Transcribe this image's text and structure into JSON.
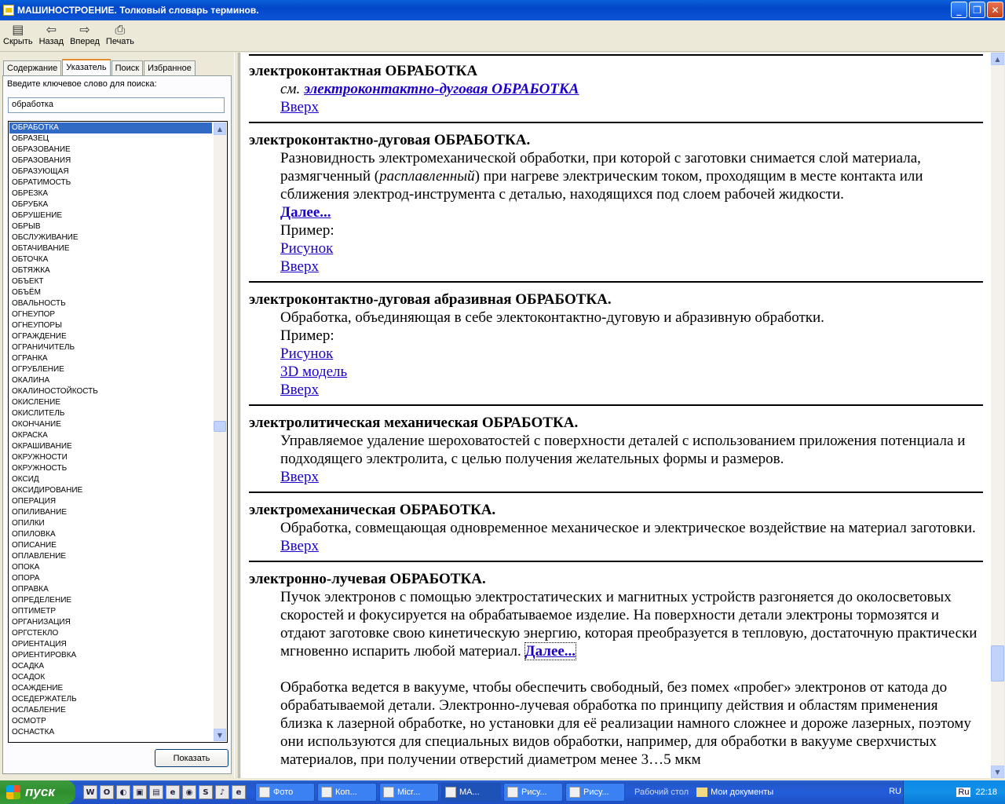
{
  "window": {
    "title": "МАШИНОСТРОЕНИЕ. Толковый словарь терминов."
  },
  "toolbar": {
    "buttons": [
      {
        "label": "Скрыть",
        "icon": "hide-icon"
      },
      {
        "label": "Назад",
        "icon": "back-arrow-icon"
      },
      {
        "label": "Вперед",
        "icon": "forward-arrow-icon"
      },
      {
        "label": "Печать",
        "icon": "printer-icon"
      }
    ]
  },
  "sidebar": {
    "tabs": [
      "Содержание",
      "Указатель",
      "Поиск",
      "Избранное"
    ],
    "active_tab": "Указатель",
    "prompt": "Введите ключевое слово для поиска:",
    "search_value": "обработка",
    "items": [
      "ОБРАБОТКА",
      "ОБРАЗЕЦ",
      "ОБРАЗОВАНИЕ",
      "ОБРАЗОВАНИЯ",
      "ОБРАЗУЮЩАЯ",
      "ОБРАТИМОСТЬ",
      "ОБРЕЗКА",
      "ОБРУБКА",
      "ОБРУШЕНИЕ",
      "ОБРЫВ",
      "ОБСЛУЖИВАНИЕ",
      "ОБТАЧИВАНИЕ",
      "ОБТОЧКА",
      "ОБТЯЖКА",
      "ОБЪЕКТ",
      "ОБЪЁМ",
      "ОВАЛЬНОСТЬ",
      "ОГНЕУПОР",
      "ОГНЕУПОРЫ",
      "ОГРАЖДЕНИЕ",
      "ОГРАНИЧИТЕЛЬ",
      "ОГРАНКА",
      "ОГРУБЛЕНИЕ",
      "ОКАЛИНА",
      "ОКАЛИНОСТОЙКОСТЬ",
      "ОКИСЛЕНИЕ",
      "ОКИСЛИТЕЛЬ",
      "ОКОНЧАНИЕ",
      "ОКРАСКА",
      "ОКРАШИВАНИЕ",
      "ОКРУЖНОСТИ",
      "ОКРУЖНОСТЬ",
      "ОКСИД",
      "ОКСИДИРОВАНИЕ",
      "ОПЕРАЦИЯ",
      "ОПИЛИВАНИЕ",
      "ОПИЛКИ",
      "ОПИЛОВКА",
      "ОПИСАНИЕ",
      "ОПЛАВЛЕНИЕ",
      "ОПОКА",
      "ОПОРА",
      "ОПРАВКА",
      "ОПРЕДЕЛЕНИЕ",
      "ОПТИМЕТР",
      "ОРГАНИЗАЦИЯ",
      "ОРГСТЕКЛО",
      "ОРИЕНТАЦИЯ",
      "ОРИЕНТИРОВКА",
      "ОСАДКА",
      "ОСАДОК",
      "ОСАЖДЕНИЕ",
      "ОСЕДЕРЖАТЕЛЬ",
      "ОСЛАБЛЕНИЕ",
      "ОСМОТР",
      "ОСНАСТКА"
    ],
    "show_button": "Показать"
  },
  "content": {
    "entries": [
      {
        "term": "электроконтактная ОБРАБОТКА",
        "see_prefix": "см.",
        "see_link": "электроконтактно-дуговая ОБРАБОТКА",
        "top": "Вверх"
      },
      {
        "term": "электроконтактно-дуговая ОБРАБОТКА.",
        "def_a": "Разновидность электромеханической обработки, при которой с заготовки снимается слой материала, размягченный (",
        "def_italic": "расплавленный",
        "def_b": ") при нагреве электрическим током, проходящим в месте контакта или сближения электрод-инструмента с деталью, находящихся под слоем рабочей жидкости.",
        "more": "Далее...",
        "example": "Пример:",
        "figure": "Рисунок",
        "top": "Вверх"
      },
      {
        "term": "электроконтактно-дуговая абразивная ОБРАБОТКА.",
        "def": "Обработка, объединяющая в себе электоконтактно-дуговую и абразивную обработки.",
        "example": "Пример:",
        "figure": "Рисунок",
        "model": "3D модель",
        "top": "Вверх"
      },
      {
        "term": "электролитическая механическая ОБРАБОТКА.",
        "def": "Управляемое удаление шероховатостей с поверхности деталей с использованием приложения потенциала и подходящего электролита, с целью получения желательных формы и размеров.",
        "top": "Вверх"
      },
      {
        "term": "электромеханическая ОБРАБОТКА.",
        "def": "Обработка, совмещающая одновременное механическое и электрическое воздействие на материал заготовки.",
        "top": "Вверх"
      },
      {
        "term": "электронно-лучевая ОБРАБОТКА.",
        "def": "Пучок электронов с помощью электростатических и магнитных устройств разгоняется до околосветовых скоростей и фокусируется на обрабатываемое изделие. На поверхности детали электроны тормозятся и отдают заготовке свою кинетическую энергию, которая преобразуется в тепловую, достаточную практически мгновенно испарить любой материал.",
        "more": "Далее...",
        "def2": "Обработка ведется в вакууме, чтобы обеспечить свободный, без помех «пробег» электронов от катода до обрабатываемой детали. Электронно-лучевая обработка по принципу действия и областям применения близка к лазерной обработке, но установки для её реализации намного сложнее и дороже лазерных, поэтому они используются для специальных видов обработки, например, для обработки в вакууме сверхчистых материалов, при получении отверстий диаметром менее 3…5 мкм"
      }
    ]
  },
  "taskbar": {
    "start": "пуск",
    "quicklaunch": [
      "W",
      "O",
      "◐",
      "▣",
      "▤",
      "e",
      "◉",
      "S",
      "♪",
      "e"
    ],
    "tasks": [
      "Фото",
      "Коп...",
      "Micr...",
      "МА...",
      "Рису...",
      "Рису..."
    ],
    "desktop_label": "Рабочий стол",
    "docs_label": "Мои документы",
    "lang": "RU",
    "ime": "Ru",
    "clock": "22:18"
  },
  "colors": {
    "link": "#1a00c8",
    "selection": "#316ac5",
    "titlebar": "#0346c9",
    "start": "#2f8f2f"
  }
}
